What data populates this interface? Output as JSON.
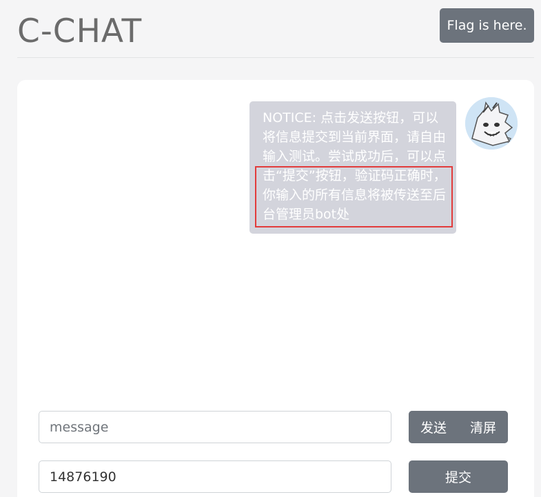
{
  "header": {
    "title": "C-CHAT",
    "flag_button": "Flag is here."
  },
  "chat": {
    "messages": [
      {
        "text": "NOTICE: 点击发送按钮，可以将信息提交到当前界面，请自由输入测试。尝试成功后，可以点击“提交”按钮，验证码正确时，你输入的所有信息将被传送至后台管理员bot处",
        "avatar": "anime-character-avatar"
      }
    ]
  },
  "composer": {
    "message_placeholder": "message",
    "message_value": "",
    "send_label": "发送",
    "clear_label": "清屏",
    "code_value": "14876190",
    "submit_label": "提交"
  },
  "colors": {
    "button": "#6c737c",
    "bubble": "#d3d4dc",
    "highlight": "#e23b3b",
    "background": "#f5f5f6"
  }
}
